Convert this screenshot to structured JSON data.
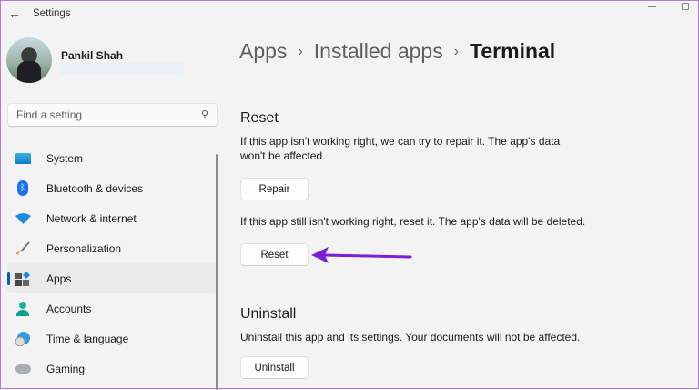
{
  "window": {
    "title": "Settings"
  },
  "user": {
    "name": "Pankil Shah"
  },
  "search": {
    "placeholder": "Find a setting"
  },
  "nav": [
    {
      "label": "System",
      "icon": "system-icon"
    },
    {
      "label": "Bluetooth & devices",
      "icon": "bluetooth-icon"
    },
    {
      "label": "Network & internet",
      "icon": "wifi-icon"
    },
    {
      "label": "Personalization",
      "icon": "brush-icon"
    },
    {
      "label": "Apps",
      "icon": "apps-icon",
      "active": true
    },
    {
      "label": "Accounts",
      "icon": "person-icon"
    },
    {
      "label": "Time & language",
      "icon": "globe-clock-icon"
    },
    {
      "label": "Gaming",
      "icon": "gamepad-icon"
    }
  ],
  "breadcrumb": {
    "items": [
      "Apps",
      "Installed apps"
    ],
    "current": "Terminal"
  },
  "reset_section": {
    "title": "Reset",
    "repair_desc": "If this app isn't working right, we can try to repair it. The app's data won't be affected.",
    "repair_label": "Repair",
    "reset_desc": "If this app still isn't working right, reset it. The app's data will be deleted.",
    "reset_label": "Reset"
  },
  "uninstall_section": {
    "title": "Uninstall",
    "desc": "Uninstall this app and its settings. Your documents will not be affected.",
    "uninstall_label": "Uninstall"
  },
  "colors": {
    "accent": "#005fb8",
    "annotation_arrow": "#7b1fd1"
  }
}
